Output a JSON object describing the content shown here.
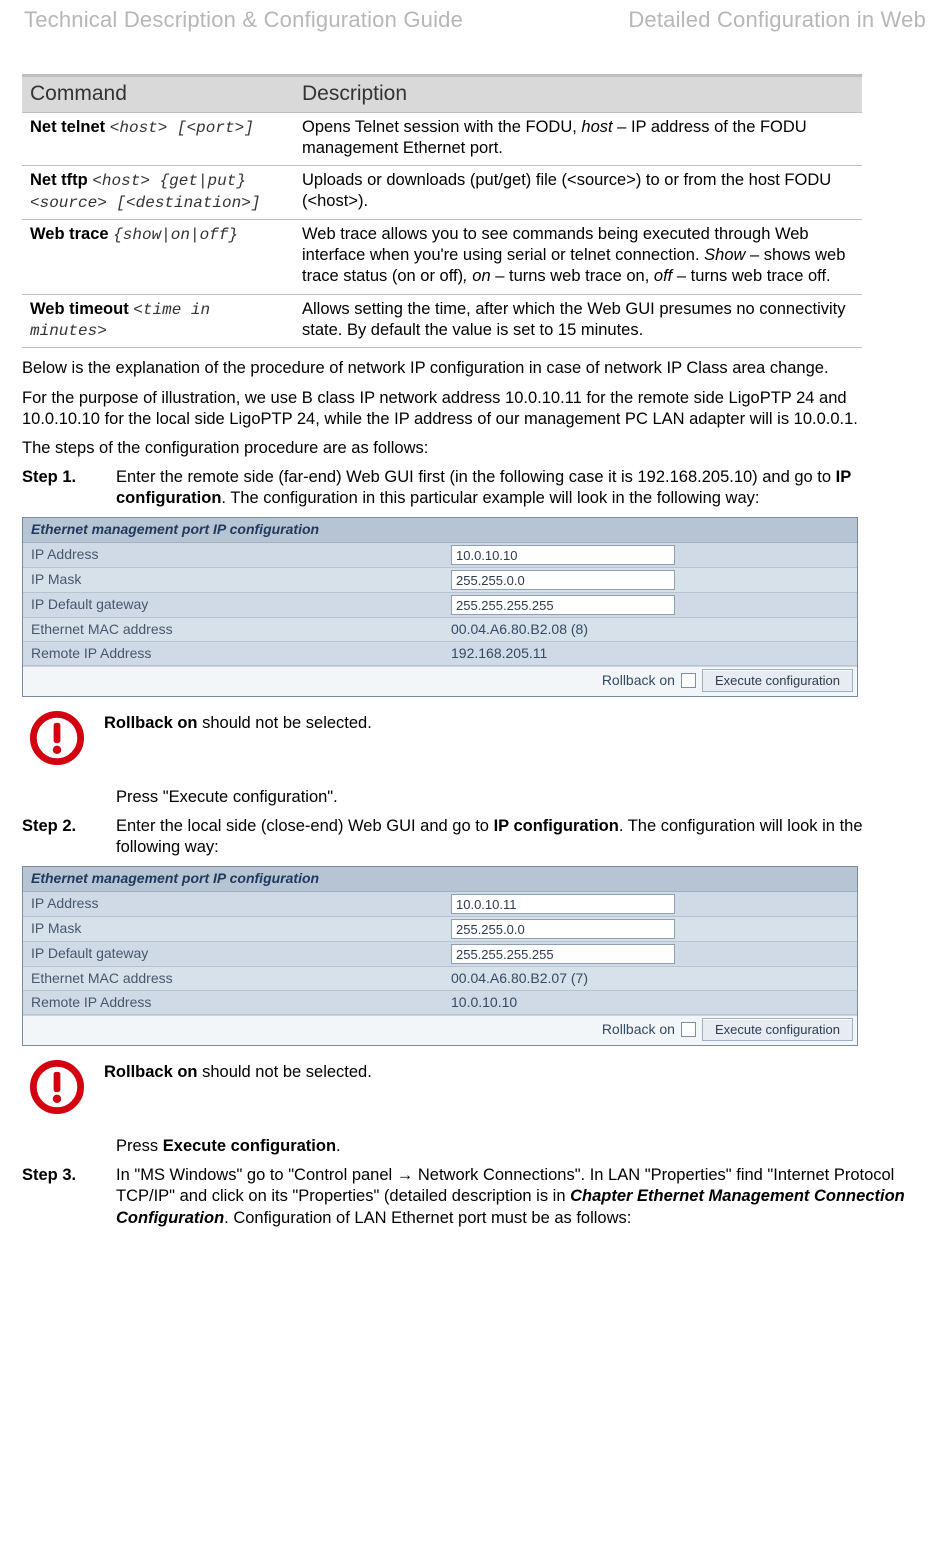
{
  "header": {
    "left": "Technical Description & Configuration Guide",
    "right_prefix": "Detailed ",
    "right_suffix": "Configuration in Web"
  },
  "command_table": {
    "col1": "Command",
    "col2": "Description",
    "rows": [
      {
        "cmd_bold": "Net telnet ",
        "cmd_args": "<host> [<port>]",
        "desc_pre": "Opens Telnet session with the FODU, ",
        "desc_it": "host",
        "desc_post": " – IP address of the FODU management Ethernet port."
      },
      {
        "cmd_bold": "Net tftp ",
        "cmd_args": "<host> {get|put} <source> [<destination>]",
        "desc_pre": "Uploads or downloads (put/get) file (<source>) to or from the host FODU (<host>).",
        "desc_it": "",
        "desc_post": ""
      },
      {
        "cmd_bold": "Web trace ",
        "cmd_args": "{show|on|off}",
        "desc_segments": {
          "a": "Web trace allows you to see commands being executed through Web interface when you're using serial or telnet connection. ",
          "show": "Show",
          "b": " – shows web trace status (on or off)",
          "comma_it": ", on",
          "c": " – turns web trace on, ",
          "off": "off",
          "d": " – turns web trace off."
        }
      },
      {
        "cmd_bold": "Web timeout ",
        "cmd_args": "<time in minutes>",
        "desc_pre": "Allows setting the time, after which the Web GUI presumes no connectivity state. By default the value is set to 15 minutes.",
        "desc_it": "",
        "desc_post": ""
      }
    ]
  },
  "paragraphs": {
    "p1": "Below is the explanation of the procedure of network IP configuration in case of network IP Class area change.",
    "p2": "For the purpose of illustration, we use B class IP network address 10.0.10.11 for the remote side LigoPTP 24 and 10.0.10.10 for the local side LigoPTP 24, while the IP address of our management PC LAN adapter will is 10.0.0.1.",
    "p3": "The steps of the configuration procedure are as follows:"
  },
  "step1": {
    "label": "Step 1.",
    "body_a": " Enter the remote side (far-end) Web GUI first (in the following case it is 192.168.205.10) and go to ",
    "body_bold": "IP configuration",
    "body_b": ". The configuration in this particular example will look in the following way:"
  },
  "warn1": {
    "bold": "Rollback on",
    "rest": " should not be selected."
  },
  "press1": "Press \"Execute configuration\".",
  "step2": {
    "label": "Step 2.",
    "body_a": "Enter the local side (close-end) Web GUI and go to ",
    "body_bold": "IP configuration",
    "body_b": ". The configuration will look in the following way:"
  },
  "warn2": {
    "bold": "Rollback on",
    "rest": " should not be selected."
  },
  "press2_a": "Press ",
  "press2_b": "Execute configuration",
  "press2_c": ".",
  "step3": {
    "label": "Step 3.",
    "body_a": " In \"MS Windows\" go to \"Control panel → Network Connections\". In LAN \"Properties\" find \"Internet Protocol TCP/IP\" and click on its \"Properties\" (detailed description is in ",
    "body_bi": "Chapter Ethernet Management Connection Configuration",
    "body_b": ". Configuration of LAN Ethernet port must be as follows:"
  },
  "ipconf1": {
    "title": "Ethernet management port IP configuration",
    "rows": [
      {
        "label": "IP Address",
        "input": "10.0.10.10"
      },
      {
        "label": "IP Mask",
        "input": "255.255.0.0"
      },
      {
        "label": "IP Default gateway",
        "input": "255.255.255.255"
      },
      {
        "label": "Ethernet MAC address",
        "value": "00.04.A6.80.B2.08 (8)"
      },
      {
        "label": "Remote IP Address",
        "value": "192.168.205.11"
      }
    ],
    "rollback_label": "Rollback on",
    "exec_label": "Execute configuration"
  },
  "ipconf2": {
    "title": "Ethernet management port IP configuration",
    "rows": [
      {
        "label": "IP Address",
        "input": "10.0.10.11"
      },
      {
        "label": "IP Mask",
        "input": "255.255.0.0"
      },
      {
        "label": "IP Default gateway",
        "input": "255.255.255.255"
      },
      {
        "label": "Ethernet MAC address",
        "value": "00.04.A6.80.B2.07 (7)"
      },
      {
        "label": "Remote IP Address",
        "value": "10.0.10.10"
      }
    ],
    "rollback_label": "Rollback on",
    "exec_label": "Execute configuration"
  }
}
